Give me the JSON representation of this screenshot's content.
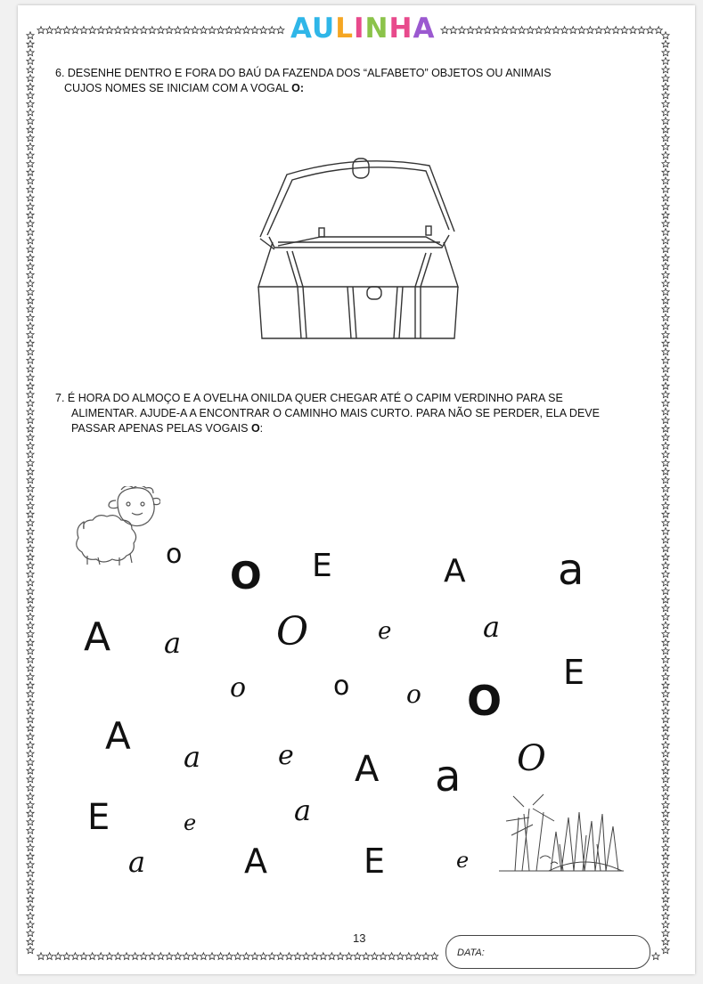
{
  "logo": {
    "letters": [
      "A",
      "U",
      "L",
      "I",
      "N",
      "H",
      "A"
    ],
    "colors": [
      "#2fb6e8",
      "#2fb6e8",
      "#f5a623",
      "#e84a8c",
      "#8bc34a",
      "#e84a8c",
      "#9b59d0"
    ]
  },
  "q6": {
    "line1": "6. DESENHE DENTRO E FORA DO BAÚ DA FAZENDA DOS “ALFABETO” OBJETOS OU ANIMAIS",
    "line2_text": "CUJOS NOMES SE INICIAM COM A VOGAL ",
    "line2_bold": "O:"
  },
  "q7": {
    "line1": "7. É HORA DO ALMOÇO E A OVELHA ONILDA QUER CHEGAR ATÉ O CAPIM VERDINHO PARA SE",
    "line2": "ALIMENTAR.  AJUDE-A A ENCONTRAR O CAMINHO MAIS CURTO. PARA NÃO SE PERDER, ELA DEVE",
    "line3_text": "PASSAR APENAS PELAS VOGAIS ",
    "line3_bold": "O",
    "line3_end": ":"
  },
  "maze_letters": [
    {
      "char": "o"
    },
    {
      "char": "O"
    },
    {
      "char": "E"
    },
    {
      "char": "A"
    },
    {
      "char": "a"
    },
    {
      "char": "A"
    },
    {
      "char": "a"
    },
    {
      "char": "O"
    },
    {
      "char": "e"
    },
    {
      "char": "a"
    },
    {
      "char": "o"
    },
    {
      "char": "o"
    },
    {
      "char": "o"
    },
    {
      "char": "O"
    },
    {
      "char": "E"
    },
    {
      "char": "A"
    },
    {
      "char": "a"
    },
    {
      "char": "e"
    },
    {
      "char": "A"
    },
    {
      "char": "a"
    },
    {
      "char": "O"
    },
    {
      "char": "E"
    },
    {
      "char": "e"
    },
    {
      "char": "a"
    },
    {
      "char": "a"
    },
    {
      "char": "A"
    },
    {
      "char": "E"
    },
    {
      "char": "e"
    }
  ],
  "footer": {
    "page_number": "13",
    "date_label": "DATA:"
  }
}
